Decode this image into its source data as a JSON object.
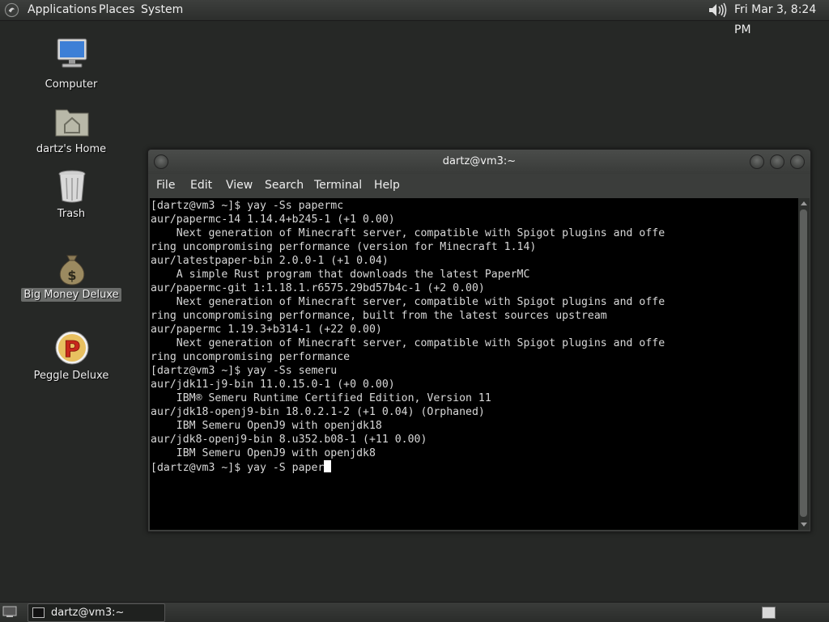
{
  "top_panel": {
    "menus": [
      "Applications",
      "Places",
      "System"
    ],
    "clock": "Fri Mar  3,  8:24 PM"
  },
  "desktop_icons": [
    {
      "label": "Computer"
    },
    {
      "label": "dartz's Home"
    },
    {
      "label": "Trash"
    },
    {
      "label": "Big Money Deluxe",
      "selected": true
    },
    {
      "label": "Peggle Deluxe"
    }
  ],
  "terminal": {
    "title": "dartz@vm3:~",
    "menus": [
      "File",
      "Edit",
      "View",
      "Search",
      "Terminal",
      "Help"
    ],
    "lines": [
      "[dartz@vm3 ~]$ yay -Ss papermc",
      "aur/papermc-14 1.14.4+b245-1 (+1 0.00)",
      "    Next generation of Minecraft server, compatible with Spigot plugins and offe",
      "ring uncompromising performance (version for Minecraft 1.14)",
      "aur/latestpaper-bin 2.0.0-1 (+1 0.04)",
      "    A simple Rust program that downloads the latest PaperMC",
      "aur/papermc-git 1:1.18.1.r6575.29bd57b4c-1 (+2 0.00)",
      "    Next generation of Minecraft server, compatible with Spigot plugins and offe",
      "ring uncompromising performance, built from the latest sources upstream",
      "aur/papermc 1.19.3+b314-1 (+22 0.00)",
      "    Next generation of Minecraft server, compatible with Spigot plugins and offe",
      "ring uncompromising performance",
      "[dartz@vm3 ~]$ yay -Ss semeru",
      "aur/jdk11-j9-bin 11.0.15.0-1 (+0 0.00)",
      "    IBM® Semeru Runtime Certified Edition, Version 11",
      "aur/jdk18-openj9-bin 18.0.2.1-2 (+1 0.04) (Orphaned)",
      "    IBM Semeru OpenJ9 with openjdk18",
      "aur/jdk8-openj9-bin 8.u352.b08-1 (+11 0.00)",
      "    IBM Semeru OpenJ9 with openjdk8"
    ],
    "prompt": "[dartz@vm3 ~]$ yay -S paper"
  },
  "bottom_panel": {
    "task_label": "dartz@vm3:~"
  },
  "colors": {
    "desktop": "#262826",
    "terminal_bg": "#000000",
    "terminal_fg": "#d8d8d8"
  }
}
